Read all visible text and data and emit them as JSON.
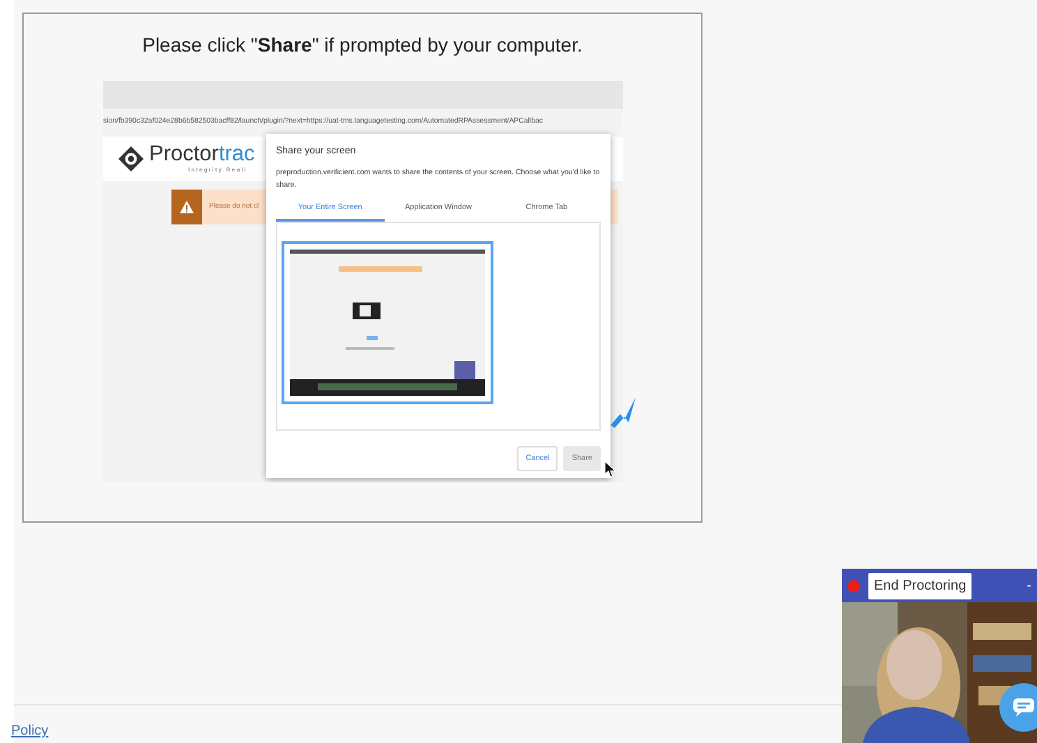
{
  "prompt": "Please click \"**Share**\" if prompted by your computer.",
  "shared_page": {
    "url": "sion/fb390c32af024e28b6b582503bacff82/launch/plugin/?next=https://uat-tms.languagetesting.com/AutomatedRPAssessment/APCallbac",
    "logo": {
      "name_dark": "Proctor",
      "name_accent": "trac",
      "tagline": "Integrity Reali"
    },
    "warning": "Please do not cl"
  },
  "dialog": {
    "title": "Share your screen",
    "message": "preproduction.verificient.com wants to share the contents of your screen. Choose what you'd like to share.",
    "tabs": [
      {
        "label": "Your Entire Screen",
        "selected": true
      },
      {
        "label": "Application Window",
        "selected": false
      },
      {
        "label": "Chrome Tab",
        "selected": false
      }
    ],
    "buttons": [
      {
        "label": "Cancel",
        "kind": "secondary"
      },
      {
        "label": "Share",
        "kind": "primary"
      }
    ]
  },
  "proctor_widget": {
    "recording": true,
    "button": "End Proctoring",
    "minimize": "-"
  },
  "footer": {
    "link": "Policy"
  }
}
